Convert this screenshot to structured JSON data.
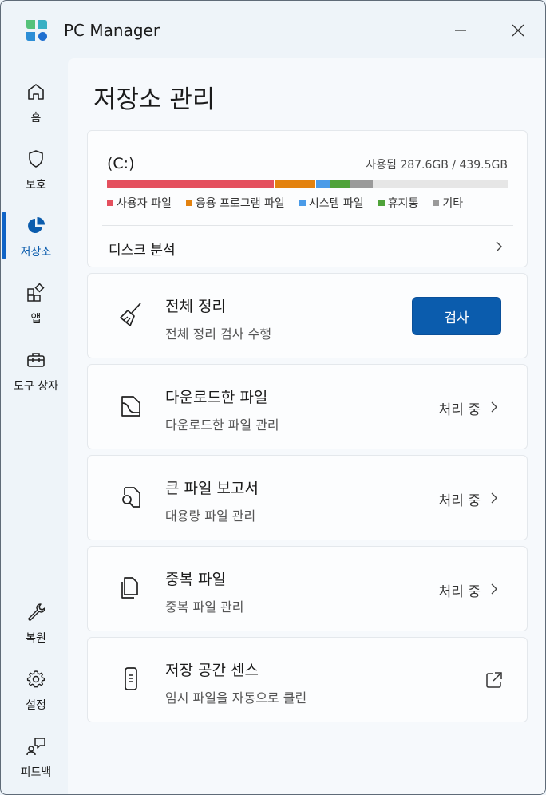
{
  "app": {
    "title": "PC Manager"
  },
  "sidebar": {
    "items": [
      {
        "label": "홈",
        "icon": "home-icon"
      },
      {
        "label": "보호",
        "icon": "shield-icon"
      },
      {
        "label": "저장소",
        "icon": "pie-chart-icon",
        "active": true
      },
      {
        "label": "앱",
        "icon": "apps-icon"
      },
      {
        "label": "도구 상자",
        "icon": "toolbox-icon"
      }
    ],
    "bottom_items": [
      {
        "label": "복원",
        "icon": "wrench-icon"
      },
      {
        "label": "설정",
        "icon": "gear-icon"
      },
      {
        "label": "피드백",
        "icon": "feedback-icon"
      }
    ]
  },
  "page": {
    "title": "저장소 관리"
  },
  "disk": {
    "drive": "(C:)",
    "usage_text": "사용됨 287.6GB / 439.5GB",
    "used_fraction": 0.654,
    "segments": [
      {
        "label": "사용자 파일",
        "color": "#e4505e",
        "fraction": 0.418
      },
      {
        "label": "응용 프로그램 파일",
        "color": "#e3820f",
        "fraction": 0.103
      },
      {
        "label": "시스템 파일",
        "color": "#4a9be8",
        "fraction": 0.036
      },
      {
        "label": "휴지통",
        "color": "#4fa33a",
        "fraction": 0.05
      },
      {
        "label": "기타",
        "color": "#9a9a9a",
        "fraction": 0.056
      }
    ],
    "analysis_label": "디스크 분석"
  },
  "cleanup": {
    "title": "전체 정리",
    "subtitle": "전체 정리 검사 수행",
    "button_label": "검사"
  },
  "features": [
    {
      "title": "다운로드한 파일",
      "subtitle": "다운로드한 파일 관리",
      "status": "처리 중",
      "icon": "download-file-icon"
    },
    {
      "title": "큰 파일 보고서",
      "subtitle": "대용량 파일 관리",
      "status": "처리 중",
      "icon": "file-search-icon"
    },
    {
      "title": "중복 파일",
      "subtitle": "중복 파일 관리",
      "status": "처리 중",
      "icon": "duplicate-files-icon"
    }
  ],
  "storage_sense": {
    "title": "저장 공간 센스",
    "subtitle": "임시 파일을 자동으로 클린",
    "icon": "phone-icon"
  },
  "colors": {
    "accent": "#0b5cad",
    "background": "#eef4f9"
  }
}
